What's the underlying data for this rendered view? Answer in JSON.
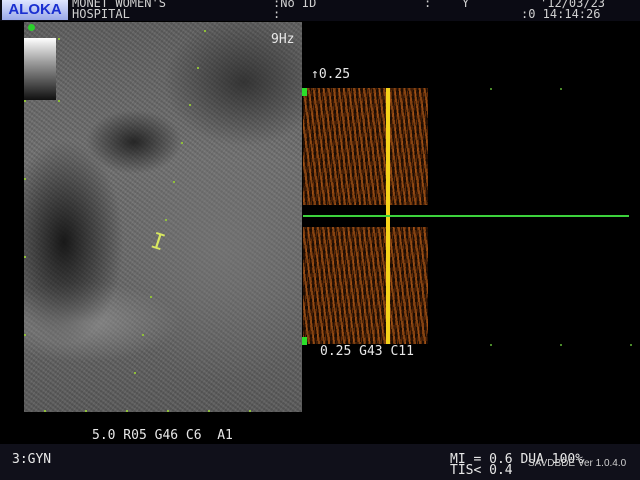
{
  "header": {
    "logo": "ALOKA",
    "hospital_line1": "MONET WOMEN'S",
    "hospital_line2": "HOSPITAL",
    "patient_id": ":No ID",
    "patient_id_line2": ":",
    "field_colon": ":",
    "field_y": "Y",
    "date": "'12/03/23",
    "time": ":0 14:14:26"
  },
  "image": {
    "frame_rate": "9Hz",
    "scale_top": "↑0.25",
    "caliper_glyph": "I",
    "bmode_params": "5.0 R05 G46 C6  A1",
    "doppler_params": "0.25 G43 C11"
  },
  "footer": {
    "preset": "3:GYN",
    "mi": "MI = 0.6 DUA 100%",
    "tis": "TIS< 0.4",
    "software": "SAVDBDE Ver 1.0.4.0"
  },
  "colors": {
    "baseline": "#3cd23c",
    "cursor": "#f5d21a",
    "logo_text": "#1a2fd0"
  }
}
